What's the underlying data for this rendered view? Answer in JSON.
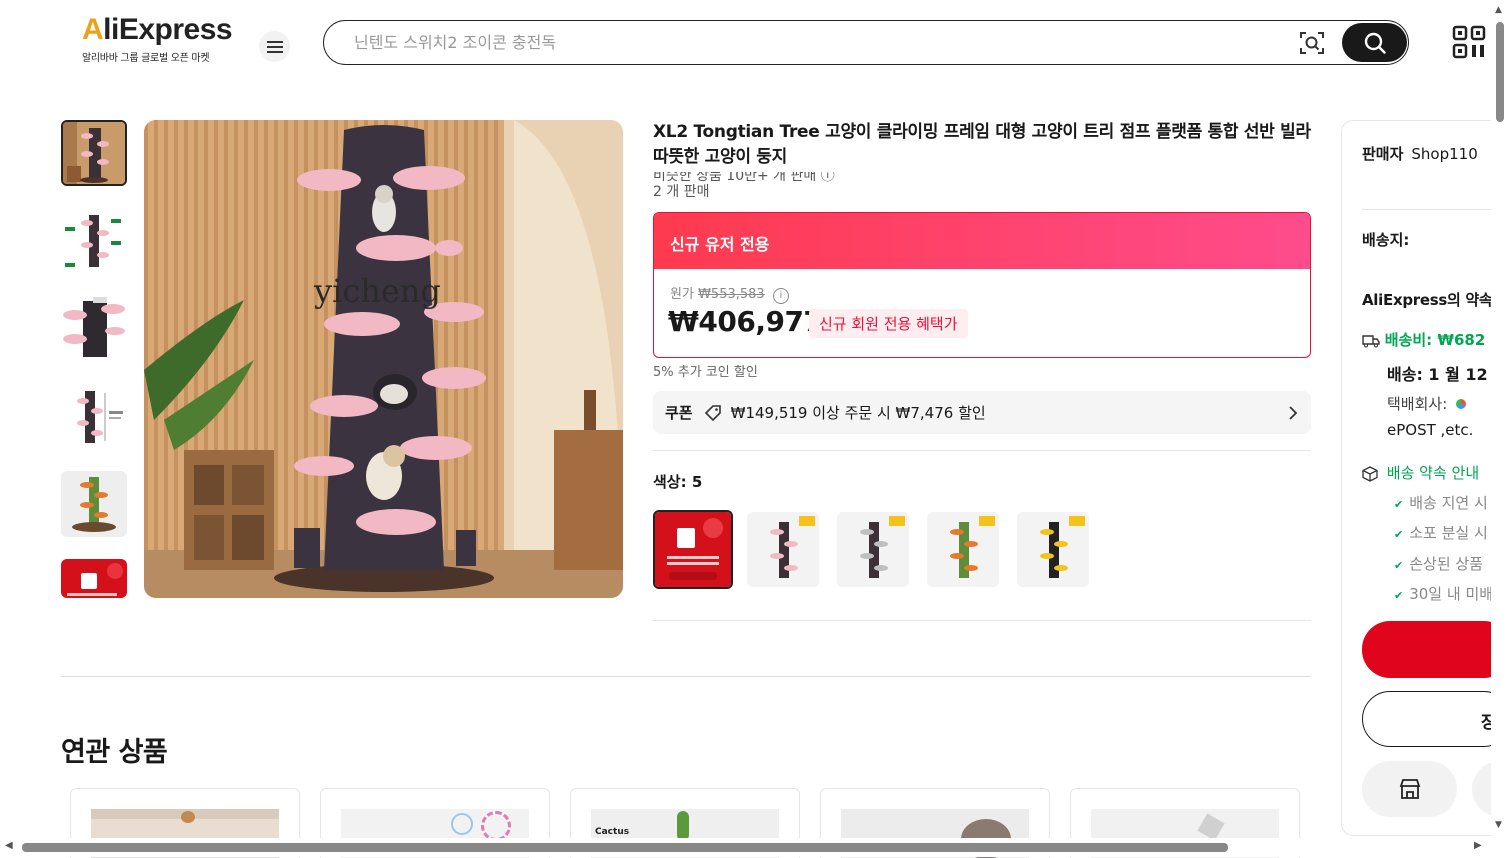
{
  "header": {
    "logo_text": "AliExpress",
    "logo_subtitle": "알리바바 그룹 글로벌 오픈 마켓",
    "search_placeholder": "닌텐도 스위치2 조이콘 충전독"
  },
  "gallery": {
    "watermark": "yicheng"
  },
  "product": {
    "title": "XL2 Tongtian Tree 고양이 클라이밍 프레임 대형 고양이 트리 점프 플랫폼 통합 선반 빌라 따뜻한 고양이 둥지",
    "sold_line_1": "비슷한 상품 10만+ 개 판매 ⓘ",
    "sold_line_2": "2 개 판매",
    "promo_header": "신규 유저 전용",
    "original_label": "원가",
    "original_price": "₩553,583",
    "price": "₩406,977",
    "price_badge": "신규 회원 전용 혜택가",
    "coin_note": "5% 추가 코인 할인",
    "coupon_label": "쿠폰",
    "coupon_text": "₩149,519 이상 주문 시 ₩7,476 할인",
    "color_label": "색상: 5"
  },
  "related": {
    "title": "연관 상품",
    "card3_text": "Cactus"
  },
  "side": {
    "seller_label": "판매자",
    "seller_name": "Shop110",
    "ship_to_label": "배송지:",
    "promise_title": "AliExpress의 약속",
    "shipping_fee": "배송비: ₩682",
    "delivery": "배송: 1 월 12",
    "courier_label": "택배회사:",
    "courier_name": "ePOST ,etc.",
    "promise_link": "배송 약속 안내",
    "promise_items": [
      "배송 지연 시",
      "소포 분실 시",
      "손상된 상품",
      "30일 내 미배"
    ],
    "cart_label": "장"
  },
  "colors": {
    "accent": "#e0041c",
    "green": "#00a650",
    "promo_gradient_start": "#fe3a4e",
    "promo_gradient_end": "#fe4c8c"
  }
}
